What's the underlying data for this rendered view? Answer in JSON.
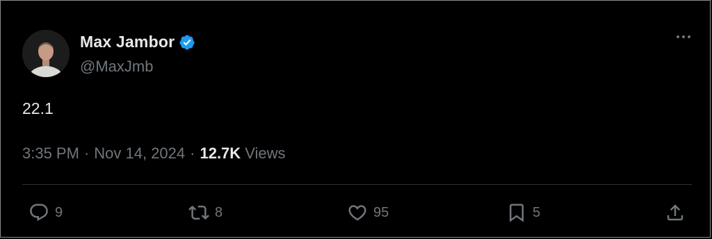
{
  "author": {
    "display_name": "Max Jambor",
    "handle": "@MaxJmb",
    "verified": true,
    "avatar_icon": "avatar-photo"
  },
  "tweet": {
    "text": "22.1",
    "time": "3:35 PM",
    "date": "Nov 14, 2024",
    "views_count": "12.7K",
    "views_label": "Views"
  },
  "actions": {
    "reply_count": "9",
    "retweet_count": "8",
    "like_count": "95",
    "bookmark_count": "5"
  },
  "colors": {
    "background": "#000000",
    "text_primary": "#e7e9ea",
    "text_secondary": "#71767b",
    "verified_blue": "#1d9bf0",
    "divider": "#2f3336"
  }
}
